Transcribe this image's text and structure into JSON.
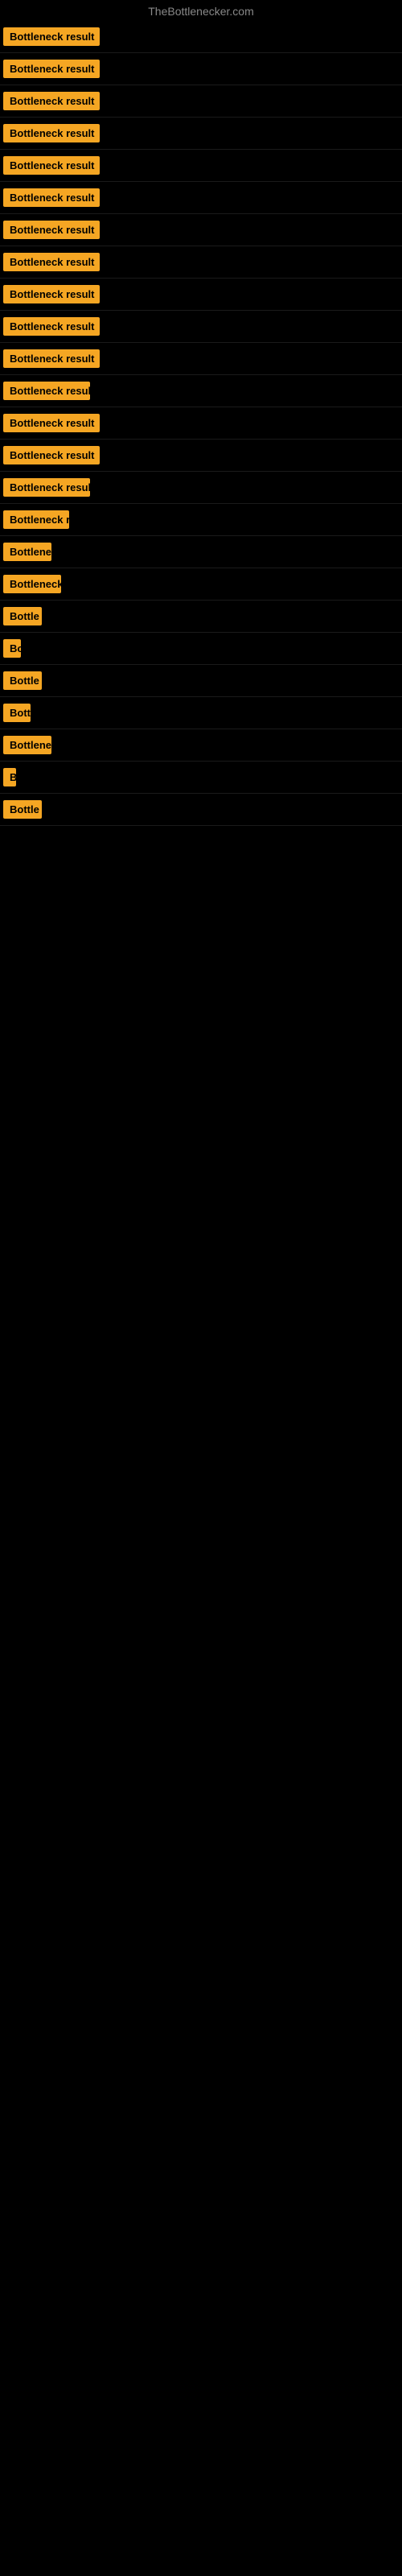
{
  "site": {
    "title": "TheBottlenecker.com"
  },
  "rows": [
    {
      "id": 1,
      "badge_text": "Bottleneck result",
      "badge_width": 120
    },
    {
      "id": 2,
      "badge_text": "Bottleneck result",
      "badge_width": 120
    },
    {
      "id": 3,
      "badge_text": "Bottleneck result",
      "badge_width": 120
    },
    {
      "id": 4,
      "badge_text": "Bottleneck result",
      "badge_width": 120
    },
    {
      "id": 5,
      "badge_text": "Bottleneck result",
      "badge_width": 120
    },
    {
      "id": 6,
      "badge_text": "Bottleneck result",
      "badge_width": 120
    },
    {
      "id": 7,
      "badge_text": "Bottleneck result",
      "badge_width": 120
    },
    {
      "id": 8,
      "badge_text": "Bottleneck result",
      "badge_width": 120
    },
    {
      "id": 9,
      "badge_text": "Bottleneck result",
      "badge_width": 120
    },
    {
      "id": 10,
      "badge_text": "Bottleneck result",
      "badge_width": 120
    },
    {
      "id": 11,
      "badge_text": "Bottleneck result",
      "badge_width": 120
    },
    {
      "id": 12,
      "badge_text": "Bottleneck resul",
      "badge_width": 108
    },
    {
      "id": 13,
      "badge_text": "Bottleneck result",
      "badge_width": 120
    },
    {
      "id": 14,
      "badge_text": "Bottleneck result",
      "badge_width": 120
    },
    {
      "id": 15,
      "badge_text": "Bottleneck resul",
      "badge_width": 108
    },
    {
      "id": 16,
      "badge_text": "Bottleneck r",
      "badge_width": 82
    },
    {
      "id": 17,
      "badge_text": "Bottlene",
      "badge_width": 60
    },
    {
      "id": 18,
      "badge_text": "Bottleneck",
      "badge_width": 72
    },
    {
      "id": 19,
      "badge_text": "Bottle",
      "badge_width": 48
    },
    {
      "id": 20,
      "badge_text": "Bo",
      "badge_width": 22
    },
    {
      "id": 21,
      "badge_text": "Bottle",
      "badge_width": 48
    },
    {
      "id": 22,
      "badge_text": "Bott",
      "badge_width": 34
    },
    {
      "id": 23,
      "badge_text": "Bottlene",
      "badge_width": 60
    },
    {
      "id": 24,
      "badge_text": "B",
      "badge_width": 14
    },
    {
      "id": 25,
      "badge_text": "Bottle",
      "badge_width": 48
    }
  ]
}
